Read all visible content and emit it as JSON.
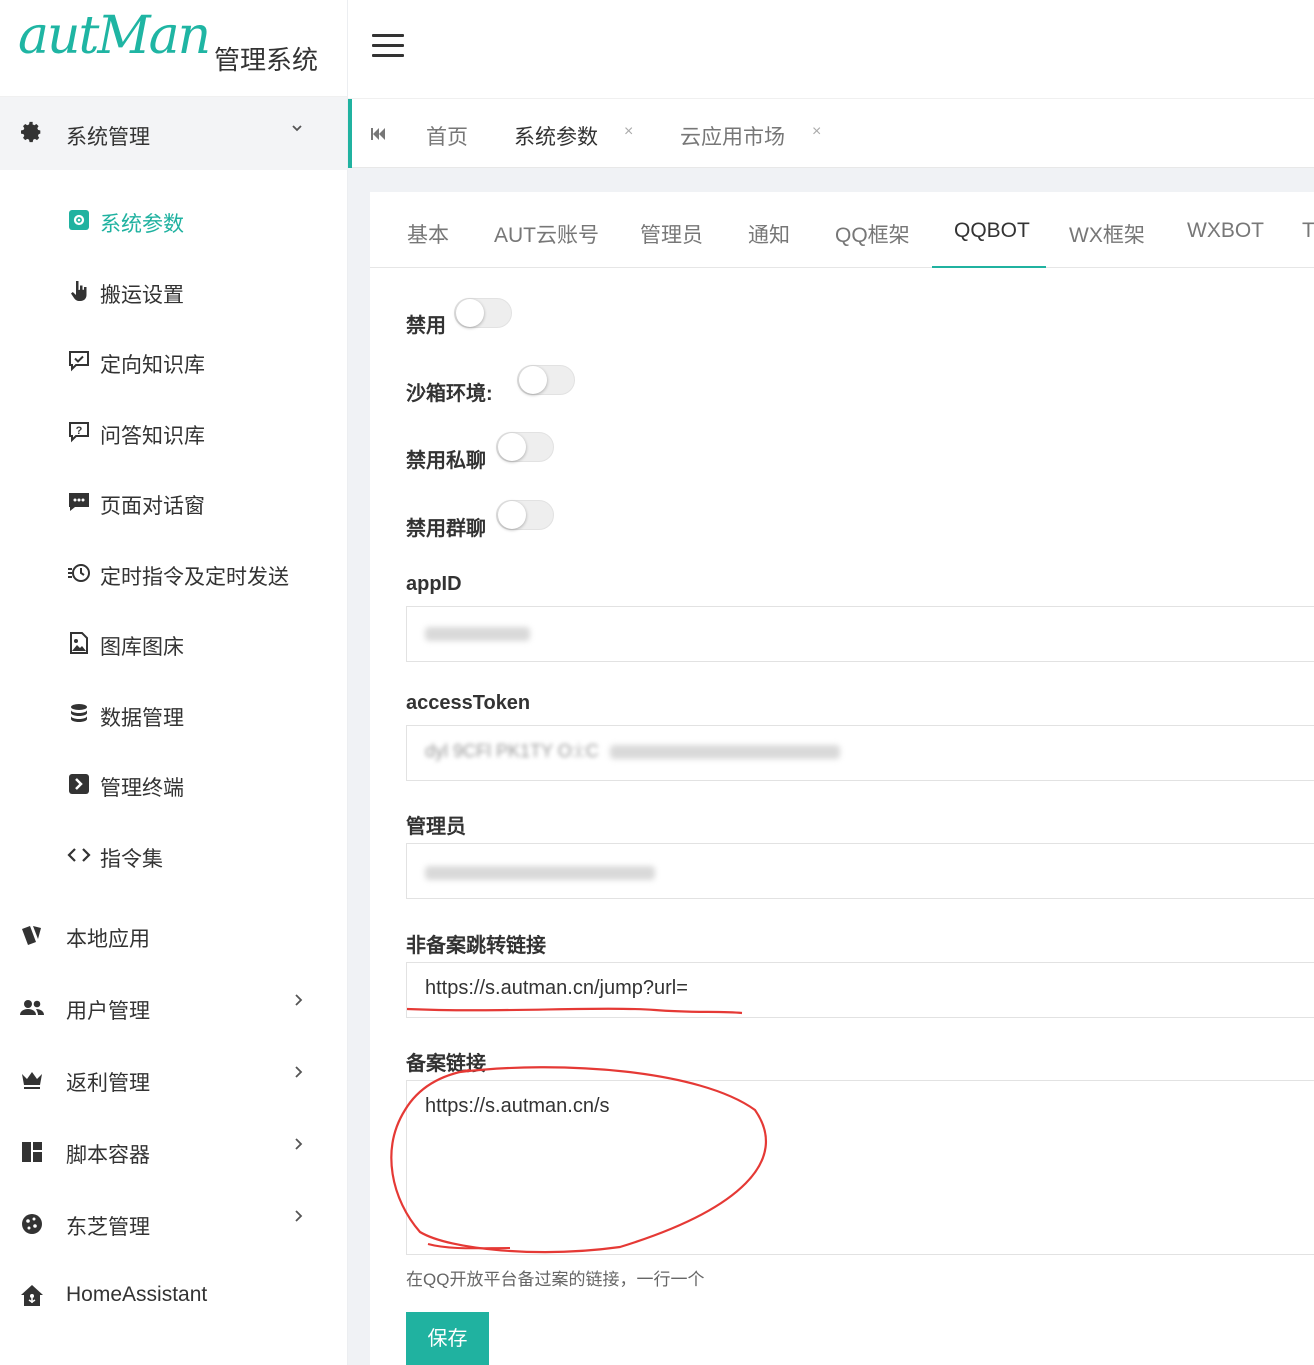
{
  "brand": {
    "logo_script": "autMan",
    "app_name": "管理系统",
    "accent": "#20b2a0"
  },
  "sidebar": {
    "group": {
      "label": "系统管理",
      "icon": "gear-icon"
    },
    "sub_items": [
      {
        "label": "系统参数",
        "icon": "settings-square-icon",
        "active": true
      },
      {
        "label": "搬运设置",
        "icon": "pointer-hand-icon"
      },
      {
        "label": "定向知识库",
        "icon": "chat-check-icon"
      },
      {
        "label": "问答知识库",
        "icon": "chat-question-icon"
      },
      {
        "label": "页面对话窗",
        "icon": "chat-dots-icon"
      },
      {
        "label": "定时指令及定时发送",
        "icon": "history-clock-icon"
      },
      {
        "label": "图库图床",
        "icon": "image-file-icon"
      },
      {
        "label": "数据管理",
        "icon": "database-icon"
      },
      {
        "label": "管理终端",
        "icon": "terminal-icon"
      },
      {
        "label": "指令集",
        "icon": "code-icon"
      }
    ],
    "top_items": [
      {
        "label": "本地应用",
        "icon": "cards-icon",
        "arrow": false
      },
      {
        "label": "用户管理",
        "icon": "users-icon",
        "arrow": true
      },
      {
        "label": "返利管理",
        "icon": "crown-icon",
        "arrow": true
      },
      {
        "label": "脚本容器",
        "icon": "dashboard-icon",
        "arrow": true
      },
      {
        "label": "东芝管理",
        "icon": "cookie-icon",
        "arrow": true
      },
      {
        "label": "HomeAssistant",
        "icon": "home-assistant-icon",
        "arrow": false
      }
    ]
  },
  "page_tabs": [
    {
      "label": "首页",
      "closable": false
    },
    {
      "label": "系统参数",
      "closable": true,
      "active": true
    },
    {
      "label": "云应用市场",
      "closable": true
    }
  ],
  "form_tabs": [
    "基本",
    "AUT云账号",
    "管理员",
    "通知",
    "QQ框架",
    "QQBOT",
    "WX框架",
    "WXBOT",
    "T"
  ],
  "active_form_tab": "QQBOT",
  "form": {
    "switches": [
      {
        "label": "禁用",
        "on": false
      },
      {
        "label": "沙箱环境:",
        "on": false
      },
      {
        "label": "禁用私聊",
        "on": false
      },
      {
        "label": "禁用群聊",
        "on": false
      }
    ],
    "appid_label": "appID",
    "token_label": "accessToken",
    "token_value_partial": "dyl 9CFl PK1TY O:i:C",
    "admin_label": "管理员",
    "jump_label": "非备案跳转链接",
    "jump_value": "https://s.autman.cn/jump?url=",
    "record_label": "备案链接",
    "record_value": "https://s.autman.cn/s",
    "hint": "在QQ开放平台备过案的链接，一行一个",
    "save_label": "保存"
  }
}
